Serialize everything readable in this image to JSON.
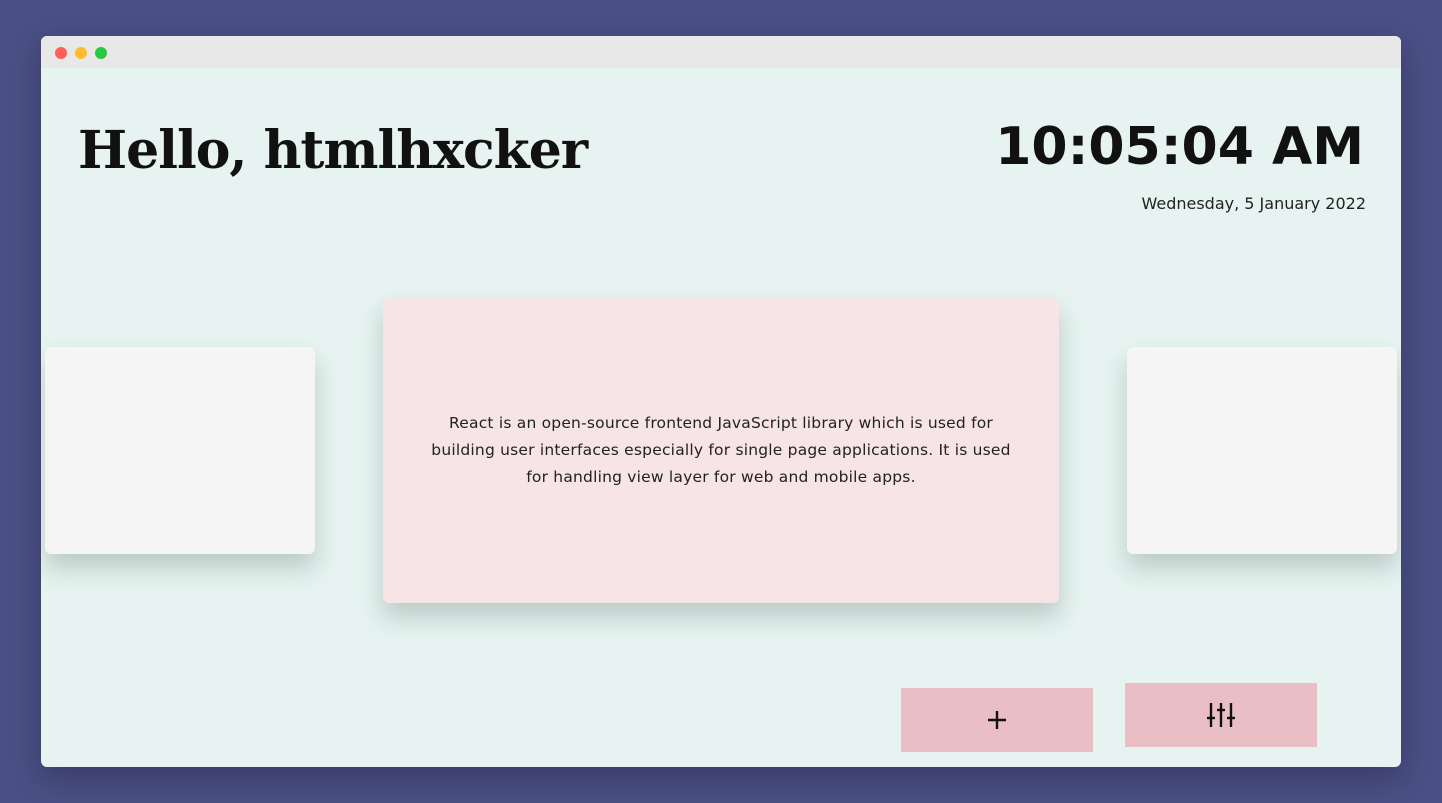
{
  "window": {
    "controls": [
      "close",
      "minimize",
      "maximize"
    ]
  },
  "header": {
    "greeting": "Hello, htmlhxcker",
    "time": "10:05:04 AM",
    "date": "Wednesday, 5 January 2022"
  },
  "carousel": {
    "active_card_text": "React is an open-source frontend JavaScript library which is used for building user interfaces especially for single page applications. It is used for handling view layer for web and mobile apps."
  },
  "actions": {
    "add_icon": "plus-icon",
    "settings_icon": "sliders-icon"
  },
  "colors": {
    "background": "#4a4f85",
    "window_bg": "#e6f3f0",
    "card_active": "#f7e4e6",
    "card_inactive": "#f5f5f5",
    "button_bg": "#e9bec4"
  }
}
